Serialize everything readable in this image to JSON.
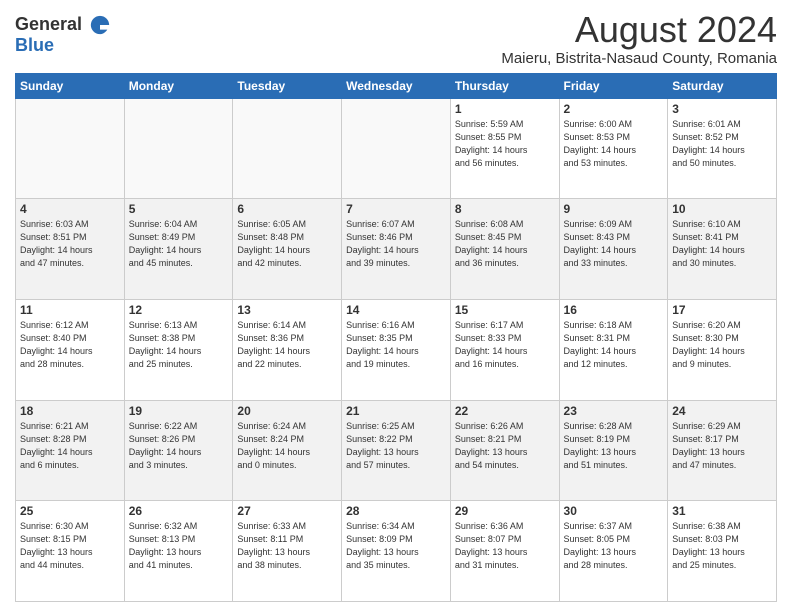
{
  "logo": {
    "general": "General",
    "blue": "Blue"
  },
  "header": {
    "month_year": "August 2024",
    "location": "Maieru, Bistrita-Nasaud County, Romania"
  },
  "columns": [
    "Sunday",
    "Monday",
    "Tuesday",
    "Wednesday",
    "Thursday",
    "Friday",
    "Saturday"
  ],
  "weeks": [
    [
      {
        "day": "",
        "info": ""
      },
      {
        "day": "",
        "info": ""
      },
      {
        "day": "",
        "info": ""
      },
      {
        "day": "",
        "info": ""
      },
      {
        "day": "1",
        "info": "Sunrise: 5:59 AM\nSunset: 8:55 PM\nDaylight: 14 hours\nand 56 minutes."
      },
      {
        "day": "2",
        "info": "Sunrise: 6:00 AM\nSunset: 8:53 PM\nDaylight: 14 hours\nand 53 minutes."
      },
      {
        "day": "3",
        "info": "Sunrise: 6:01 AM\nSunset: 8:52 PM\nDaylight: 14 hours\nand 50 minutes."
      }
    ],
    [
      {
        "day": "4",
        "info": "Sunrise: 6:03 AM\nSunset: 8:51 PM\nDaylight: 14 hours\nand 47 minutes."
      },
      {
        "day": "5",
        "info": "Sunrise: 6:04 AM\nSunset: 8:49 PM\nDaylight: 14 hours\nand 45 minutes."
      },
      {
        "day": "6",
        "info": "Sunrise: 6:05 AM\nSunset: 8:48 PM\nDaylight: 14 hours\nand 42 minutes."
      },
      {
        "day": "7",
        "info": "Sunrise: 6:07 AM\nSunset: 8:46 PM\nDaylight: 14 hours\nand 39 minutes."
      },
      {
        "day": "8",
        "info": "Sunrise: 6:08 AM\nSunset: 8:45 PM\nDaylight: 14 hours\nand 36 minutes."
      },
      {
        "day": "9",
        "info": "Sunrise: 6:09 AM\nSunset: 8:43 PM\nDaylight: 14 hours\nand 33 minutes."
      },
      {
        "day": "10",
        "info": "Sunrise: 6:10 AM\nSunset: 8:41 PM\nDaylight: 14 hours\nand 30 minutes."
      }
    ],
    [
      {
        "day": "11",
        "info": "Sunrise: 6:12 AM\nSunset: 8:40 PM\nDaylight: 14 hours\nand 28 minutes."
      },
      {
        "day": "12",
        "info": "Sunrise: 6:13 AM\nSunset: 8:38 PM\nDaylight: 14 hours\nand 25 minutes."
      },
      {
        "day": "13",
        "info": "Sunrise: 6:14 AM\nSunset: 8:36 PM\nDaylight: 14 hours\nand 22 minutes."
      },
      {
        "day": "14",
        "info": "Sunrise: 6:16 AM\nSunset: 8:35 PM\nDaylight: 14 hours\nand 19 minutes."
      },
      {
        "day": "15",
        "info": "Sunrise: 6:17 AM\nSunset: 8:33 PM\nDaylight: 14 hours\nand 16 minutes."
      },
      {
        "day": "16",
        "info": "Sunrise: 6:18 AM\nSunset: 8:31 PM\nDaylight: 14 hours\nand 12 minutes."
      },
      {
        "day": "17",
        "info": "Sunrise: 6:20 AM\nSunset: 8:30 PM\nDaylight: 14 hours\nand 9 minutes."
      }
    ],
    [
      {
        "day": "18",
        "info": "Sunrise: 6:21 AM\nSunset: 8:28 PM\nDaylight: 14 hours\nand 6 minutes."
      },
      {
        "day": "19",
        "info": "Sunrise: 6:22 AM\nSunset: 8:26 PM\nDaylight: 14 hours\nand 3 minutes."
      },
      {
        "day": "20",
        "info": "Sunrise: 6:24 AM\nSunset: 8:24 PM\nDaylight: 14 hours\nand 0 minutes."
      },
      {
        "day": "21",
        "info": "Sunrise: 6:25 AM\nSunset: 8:22 PM\nDaylight: 13 hours\nand 57 minutes."
      },
      {
        "day": "22",
        "info": "Sunrise: 6:26 AM\nSunset: 8:21 PM\nDaylight: 13 hours\nand 54 minutes."
      },
      {
        "day": "23",
        "info": "Sunrise: 6:28 AM\nSunset: 8:19 PM\nDaylight: 13 hours\nand 51 minutes."
      },
      {
        "day": "24",
        "info": "Sunrise: 6:29 AM\nSunset: 8:17 PM\nDaylight: 13 hours\nand 47 minutes."
      }
    ],
    [
      {
        "day": "25",
        "info": "Sunrise: 6:30 AM\nSunset: 8:15 PM\nDaylight: 13 hours\nand 44 minutes."
      },
      {
        "day": "26",
        "info": "Sunrise: 6:32 AM\nSunset: 8:13 PM\nDaylight: 13 hours\nand 41 minutes."
      },
      {
        "day": "27",
        "info": "Sunrise: 6:33 AM\nSunset: 8:11 PM\nDaylight: 13 hours\nand 38 minutes."
      },
      {
        "day": "28",
        "info": "Sunrise: 6:34 AM\nSunset: 8:09 PM\nDaylight: 13 hours\nand 35 minutes."
      },
      {
        "day": "29",
        "info": "Sunrise: 6:36 AM\nSunset: 8:07 PM\nDaylight: 13 hours\nand 31 minutes."
      },
      {
        "day": "30",
        "info": "Sunrise: 6:37 AM\nSunset: 8:05 PM\nDaylight: 13 hours\nand 28 minutes."
      },
      {
        "day": "31",
        "info": "Sunrise: 6:38 AM\nSunset: 8:03 PM\nDaylight: 13 hours\nand 25 minutes."
      }
    ]
  ]
}
